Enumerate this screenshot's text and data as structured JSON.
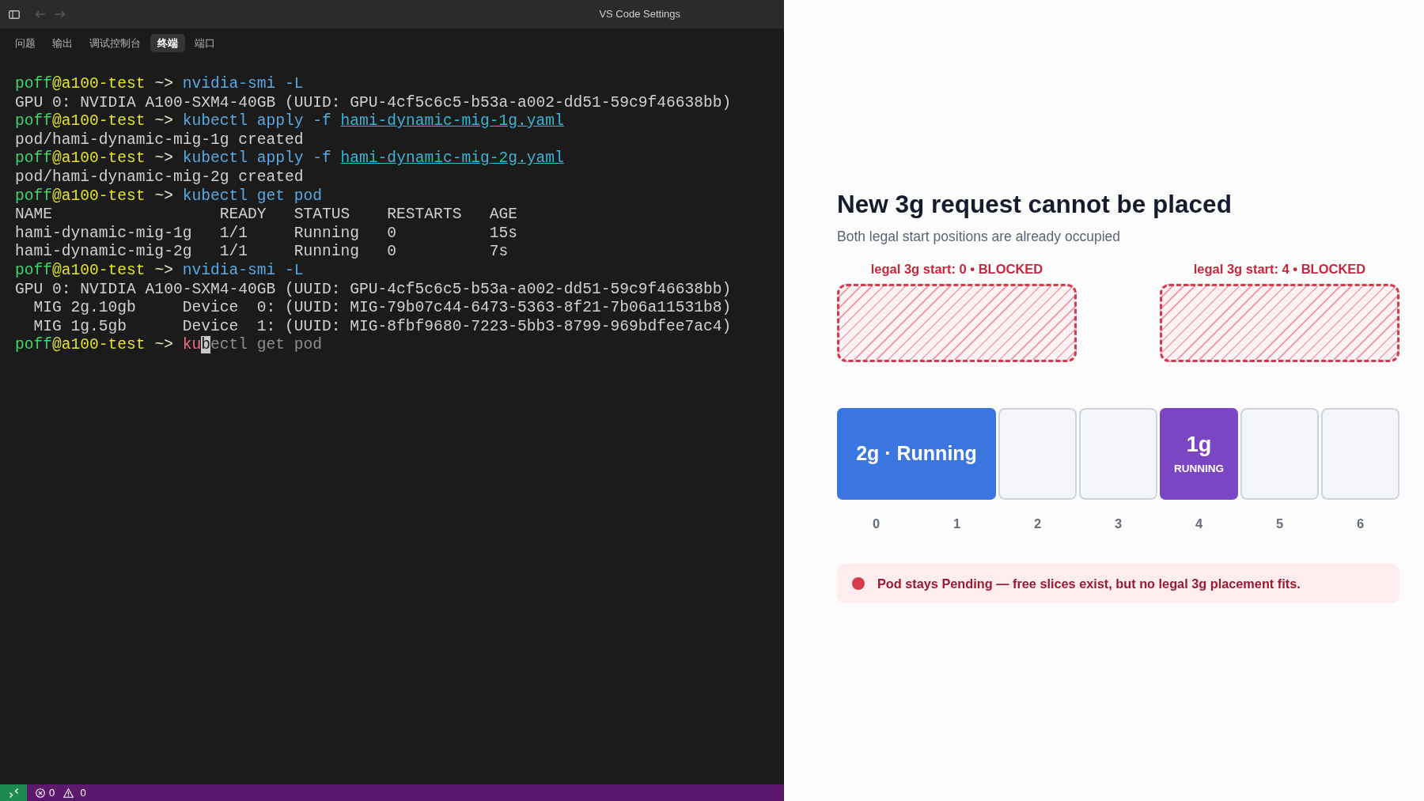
{
  "window": {
    "title": "VS Code Settings",
    "navigation": [
      {
        "kind": "back",
        "disabled": true
      },
      {
        "kind": "forward",
        "disabled": true
      }
    ]
  },
  "panel_tabs": [
    {
      "label": "问题",
      "selected": false
    },
    {
      "label": "输出",
      "selected": false
    },
    {
      "label": "调试控制台",
      "selected": false
    },
    {
      "label": "终端",
      "selected": true
    },
    {
      "label": "端口",
      "selected": false
    }
  ],
  "terminal": {
    "lines": [
      [
        {
          "kind": "user",
          "text": "poff"
        },
        {
          "kind": "host",
          "text": "@a100-test"
        },
        {
          "kind": "prompt",
          "text": " ~> "
        },
        {
          "kind": "command",
          "text": "nvidia-smi -L"
        }
      ],
      [
        {
          "kind": "output",
          "text": "GPU 0: NVIDIA A100-SXM4-40GB (UUID: GPU-4cf5c6c5-b53a-a002-dd51-59c9f46638bb)"
        }
      ],
      [
        {
          "kind": "user",
          "text": "poff"
        },
        {
          "kind": "host",
          "text": "@a100-test"
        },
        {
          "kind": "prompt",
          "text": " ~> "
        },
        {
          "kind": "command",
          "text": "kubectl apply -f "
        },
        {
          "kind": "path",
          "text": "hami-dynamic-mig-1g.yaml"
        }
      ],
      [
        {
          "kind": "output",
          "text": "pod/hami-dynamic-mig-1g created"
        }
      ],
      [
        {
          "kind": "user",
          "text": "poff"
        },
        {
          "kind": "host",
          "text": "@a100-test"
        },
        {
          "kind": "prompt",
          "text": " ~> "
        },
        {
          "kind": "command",
          "text": "kubectl apply -f "
        },
        {
          "kind": "path",
          "text": "hami-dynamic-mig-2g.yaml"
        }
      ],
      [
        {
          "kind": "output",
          "text": "pod/hami-dynamic-mig-2g created"
        }
      ],
      [
        {
          "kind": "user",
          "text": "poff"
        },
        {
          "kind": "host",
          "text": "@a100-test"
        },
        {
          "kind": "prompt",
          "text": " ~> "
        },
        {
          "kind": "command",
          "text": "kubectl get pod"
        }
      ],
      [
        {
          "kind": "output",
          "text": "NAME                  READY   STATUS    RESTARTS   AGE"
        }
      ],
      [
        {
          "kind": "output",
          "text": "hami-dynamic-mig-1g   1/1     Running   0          15s"
        }
      ],
      [
        {
          "kind": "output",
          "text": "hami-dynamic-mig-2g   1/1     Running   0          7s"
        }
      ],
      [
        {
          "kind": "user",
          "text": "poff"
        },
        {
          "kind": "host",
          "text": "@a100-test"
        },
        {
          "kind": "prompt",
          "text": " ~> "
        },
        {
          "kind": "command",
          "text": "nvidia-smi -L"
        }
      ],
      [
        {
          "kind": "output",
          "text": "GPU 0: NVIDIA A100-SXM4-40GB (UUID: GPU-4cf5c6c5-b53a-a002-dd51-59c9f46638bb)"
        }
      ],
      [
        {
          "kind": "output",
          "text": "  MIG 2g.10gb     Device  0: (UUID: MIG-79b07c44-6473-5363-8f21-7b06a11531b8)"
        }
      ],
      [
        {
          "kind": "output",
          "text": "  MIG 1g.5gb      Device  1: (UUID: MIG-8fbf9680-7223-5bb3-8799-969bdfee7ac4)"
        }
      ],
      [
        {
          "kind": "user",
          "text": "poff"
        },
        {
          "kind": "host",
          "text": "@a100-test"
        },
        {
          "kind": "prompt",
          "text": " ~> "
        },
        {
          "kind": "error",
          "text": "ku"
        },
        {
          "kind": "cursor",
          "text": "b"
        },
        {
          "kind": "suggestion",
          "text": "ectl get pod"
        }
      ]
    ]
  },
  "status_bar": {
    "errors": "0",
    "warnings": "0"
  },
  "placement_view": {
    "title": "New 3g request cannot be placed",
    "subtitle": "Both legal start positions are already occupied",
    "legal_starts": [
      {
        "label": "legal 3g start: 0 • BLOCKED",
        "blocked": true
      },
      {
        "label": "legal 3g start: 4 • BLOCKED",
        "blocked": true
      }
    ],
    "blocks": [
      {
        "kind": "wide",
        "label": "2g · Running",
        "color": "#3a75e0"
      },
      {
        "kind": "free"
      },
      {
        "kind": "free"
      },
      {
        "kind": "single",
        "label": "1g",
        "status": "RUNNING",
        "color": "#7a46c4"
      },
      {
        "kind": "free"
      },
      {
        "kind": "free"
      }
    ],
    "slot_indices": [
      "0",
      "1",
      "2",
      "3",
      "4",
      "5",
      "6"
    ],
    "alert": "Pod stays Pending — free slices exist, but no legal 3g placement fits."
  }
}
